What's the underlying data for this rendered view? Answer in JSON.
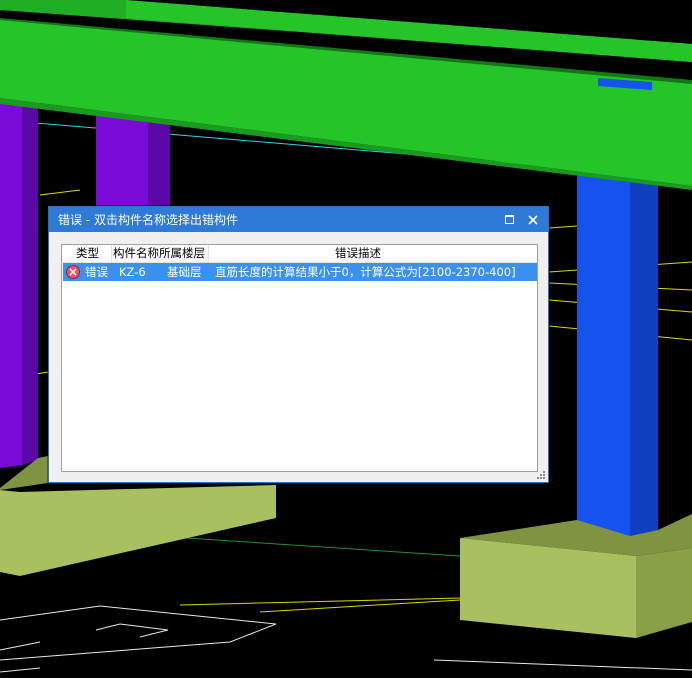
{
  "dialog": {
    "title": "错误 - 双击构件名称选择出错构件",
    "maximize_icon": "maximize-icon",
    "close_icon": "close-icon"
  },
  "table": {
    "headers": {
      "type": "类型",
      "name": "构件名称",
      "floor": "所属楼层",
      "description": "错误描述"
    },
    "rows": [
      {
        "icon": "error-icon",
        "type": "错误",
        "name": "KZ-6",
        "floor": "基础层",
        "description": "直筋长度的计算结果小于0，计算公式为[2100-2370-400]"
      }
    ]
  },
  "colors": {
    "beam": "#25c52a",
    "column_purple": "#7a0ad8",
    "column_blue": "#1552ee",
    "footing": "#a9c060",
    "titlebar": "#2e7ad6",
    "selection": "#3b91f0"
  }
}
